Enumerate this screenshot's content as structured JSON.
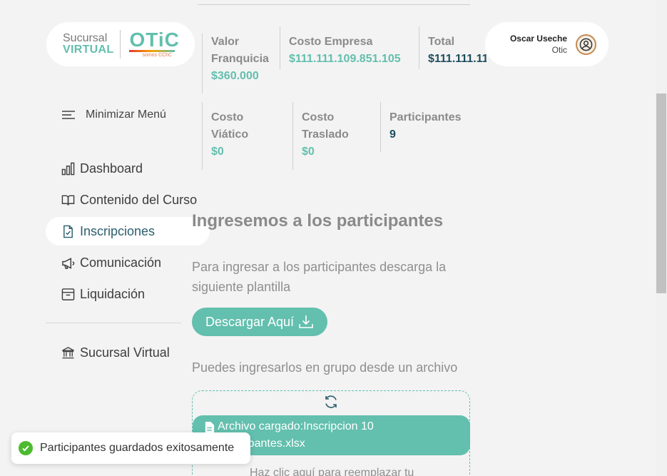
{
  "brand": {
    "line1": "Sucursal",
    "line2": "VIRTUAL",
    "logo_word": "OTiC",
    "logo_sub": "somos CChC",
    "colors": {
      "accent": "#63bfae"
    }
  },
  "user": {
    "name": "Oscar Useche",
    "org": "Otic",
    "avatar_icon": "user-circle-icon"
  },
  "stats_row1": [
    {
      "label": "Valor Franquicia",
      "value": "$360.000"
    },
    {
      "label": "Costo Empresa",
      "value": "$111.111.109.851.105"
    },
    {
      "label": "Total",
      "value": "$111.111.11"
    }
  ],
  "stats_row2": [
    {
      "label": "Costo Viático",
      "value": "$0"
    },
    {
      "label": "Costo Traslado",
      "value": "$0"
    },
    {
      "label": "Participantes",
      "value": "9"
    }
  ],
  "sidebar": {
    "toggle_label": "Minimizar Menú",
    "items": [
      {
        "label": "Dashboard",
        "icon": "bar-chart-icon"
      },
      {
        "label": "Contenido del Curso",
        "icon": "book-icon"
      },
      {
        "label": "Inscripciones",
        "icon": "file-check-icon",
        "active": true
      },
      {
        "label": "Comunicación",
        "icon": "megaphone-icon"
      },
      {
        "label": "Liquidación",
        "icon": "archive-icon"
      }
    ],
    "footer_item": {
      "label": "Sucursal Virtual",
      "icon": "bank-icon"
    }
  },
  "main": {
    "heading": "Ingresemos a los participantes",
    "instructions": "Para ingresar a los participantes descarga la siguiente plantilla",
    "download_label": "Descargar Aquí",
    "group_text": "Puedes ingresarlos en grupo desde un archivo",
    "file_loaded": "Archivo cargado:Inscripcion 10 participantes.xlsx",
    "replace_text": "Haz clic aquí para reemplazar tu"
  },
  "toast": {
    "message": "Participantes guardados exitosamente"
  }
}
